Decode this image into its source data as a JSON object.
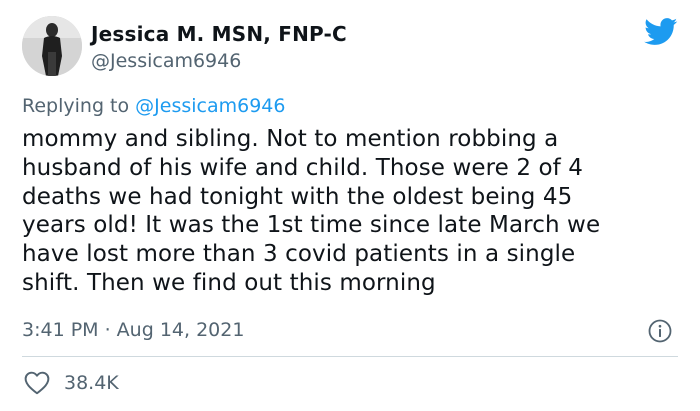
{
  "author": {
    "display_name": "Jessica M. MSN, FNP-C",
    "handle": "@Jessicam6946"
  },
  "reply": {
    "prefix": "Replying to ",
    "mention": "@Jessicam6946"
  },
  "tweet": {
    "text": "mommy and sibling.  Not to mention robbing a\nhusband of his wife and child. Those were 2 of 4\ndeaths we had tonight with the oldest being 45\nyears old! It was the 1st time since late March we\nhave lost more than 3 covid patients in a single\nshift. Then we find out this morning"
  },
  "meta": {
    "timestamp": "3:41 PM · Aug 14, 2021"
  },
  "stats": {
    "likes": "38.4K"
  },
  "icons": {
    "brand": "twitter-bird-icon",
    "info": "info-icon",
    "like": "heart-icon"
  },
  "colors": {
    "brand_blue": "#1d9bf0",
    "secondary_text": "#536471",
    "primary_text": "#0f1419",
    "divider": "#cfd9de"
  }
}
